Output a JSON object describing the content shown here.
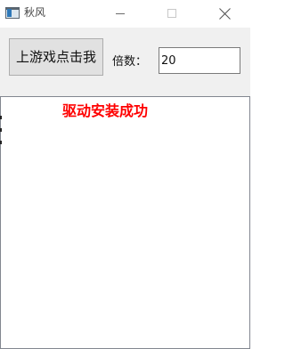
{
  "window": {
    "title": "秋风"
  },
  "toolbar": {
    "start_button_label": "上游戏点击我",
    "multiplier_label": "倍数：",
    "multiplier_value": "20"
  },
  "output": {
    "status_message": "驱动安装成功",
    "status_color": "#ff0000"
  },
  "icons": [
    "app-icon",
    "minimize-icon",
    "maximize-icon",
    "close-icon"
  ]
}
